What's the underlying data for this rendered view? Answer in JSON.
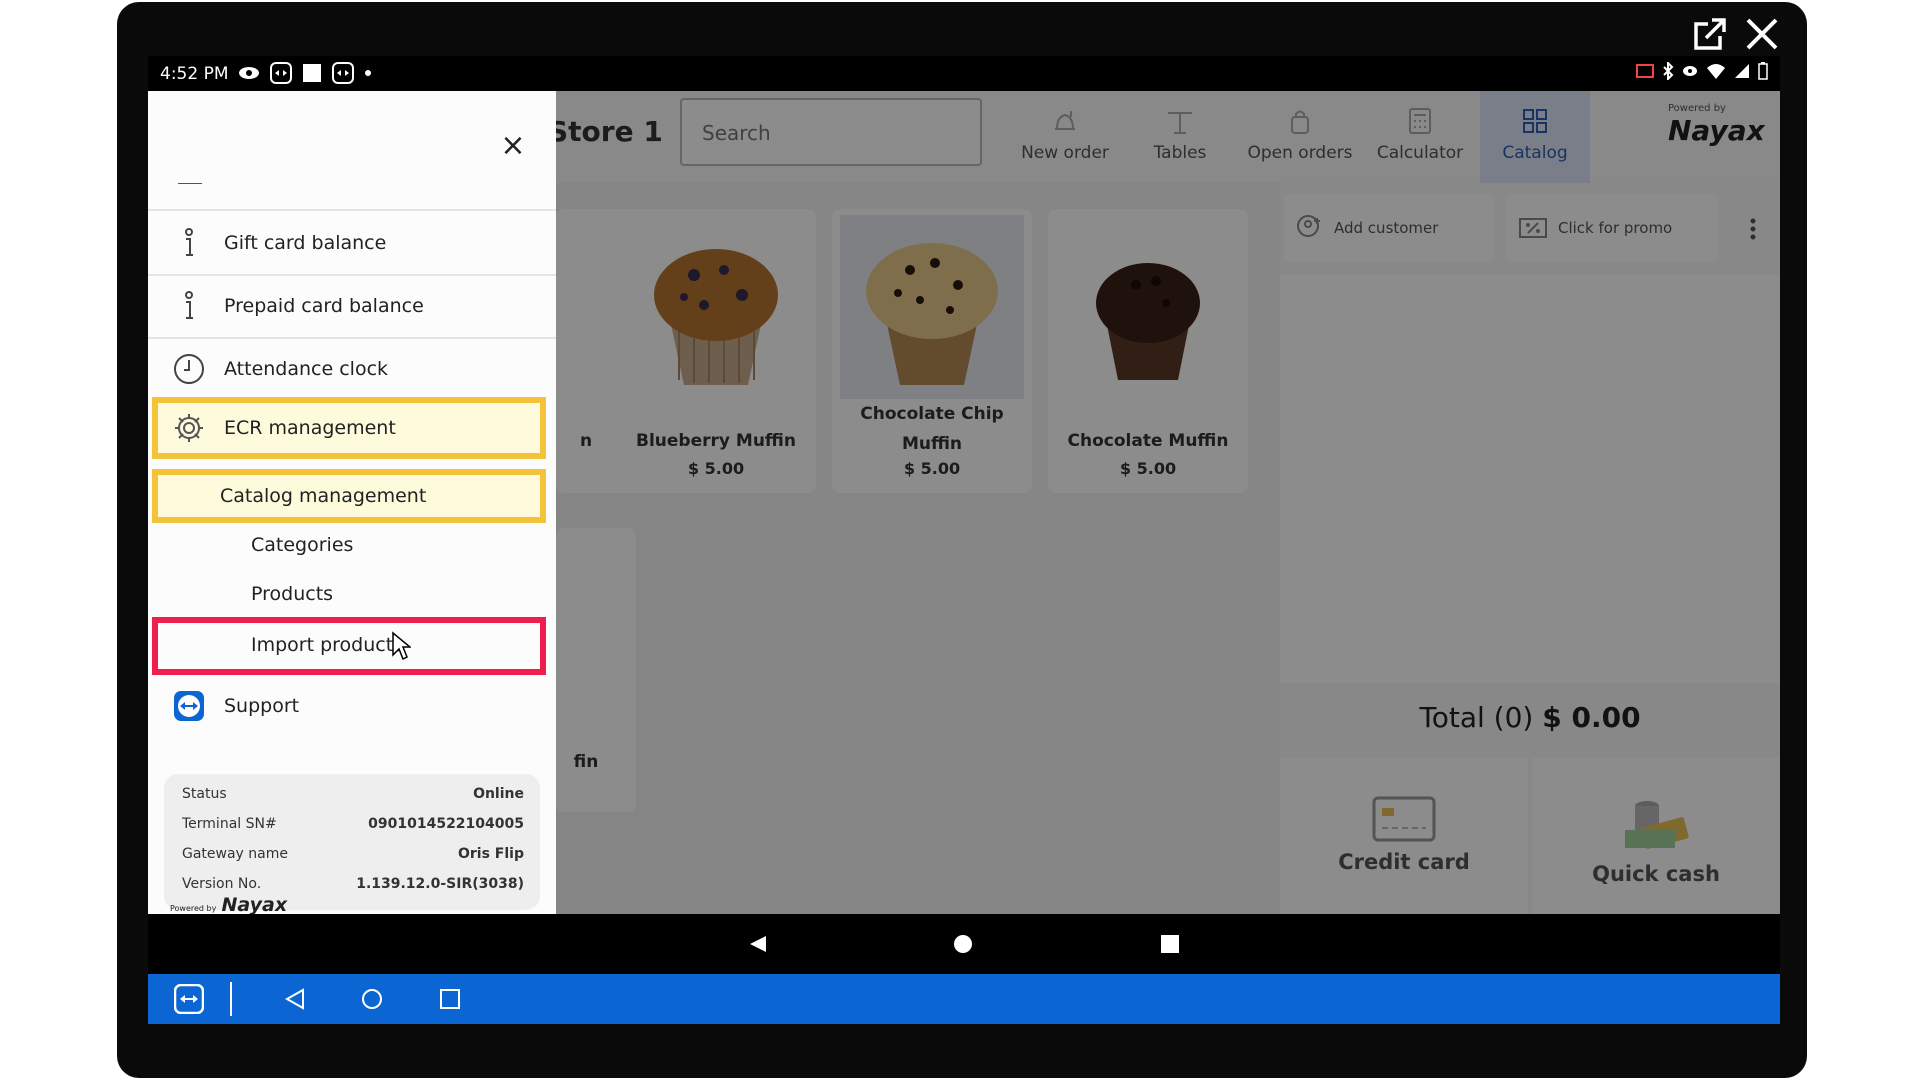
{
  "window": {
    "popout_icon": "external-link-icon",
    "close_icon": "close-icon"
  },
  "statusbar": {
    "time": "4:52 PM"
  },
  "header": {
    "store_title": "Store 1",
    "search_placeholder": "Search",
    "nav": [
      {
        "label": "New order",
        "icon": "bell-icon"
      },
      {
        "label": "Tables",
        "icon": "table-icon"
      },
      {
        "label": "Open orders",
        "icon": "bag-icon"
      },
      {
        "label": "Calculator",
        "icon": "calculator-icon"
      },
      {
        "label": "Catalog",
        "icon": "grid-icon",
        "active": true
      }
    ],
    "powered_by": "Powered by",
    "brand": "Nayax"
  },
  "products": [
    {
      "name": "Blueberry Muffin",
      "price": "$ 5.00"
    },
    {
      "name": "Chocolate Chip Muffin",
      "price": "$ 5.00"
    },
    {
      "name": "Chocolate Muffin",
      "price": "$ 5.00"
    }
  ],
  "partial_texts": {
    "card1": "n",
    "card2": "fin"
  },
  "right_panel": {
    "add_customer": "Add customer",
    "promo": "Click for promo",
    "total_label": "Total (0)",
    "total_value": "$ 0.00",
    "credit_card": "Credit card",
    "quick_cash": "Quick cash"
  },
  "drawer": {
    "menu": [
      {
        "label": "Gift card balance",
        "icon": "info-icon"
      },
      {
        "label": "Prepaid card balance",
        "icon": "info-icon"
      },
      {
        "label": "Attendance clock",
        "icon": "clock-icon"
      },
      {
        "label": "ECR management",
        "icon": "gear-icon"
      }
    ],
    "catalog_management": "Catalog management",
    "sub_items": [
      "Categories",
      "Products",
      "Import products"
    ],
    "support": "Support",
    "info": [
      {
        "label": "Status",
        "value": "Online"
      },
      {
        "label": "Terminal SN#",
        "value": "0901014522104005"
      },
      {
        "label": "Gateway name",
        "value": "Oris Flip"
      },
      {
        "label": "Version No.",
        "value": "1.139.12.0-SIR(3038)"
      }
    ],
    "powered_by": "Powered by",
    "brand": "Nayax"
  },
  "colors": {
    "highlight_yellow": "#f4c33a",
    "highlight_red": "#ef1f4d",
    "teamviewer_blue": "#0b66d3",
    "catalog_active": "#2c5fb3"
  }
}
